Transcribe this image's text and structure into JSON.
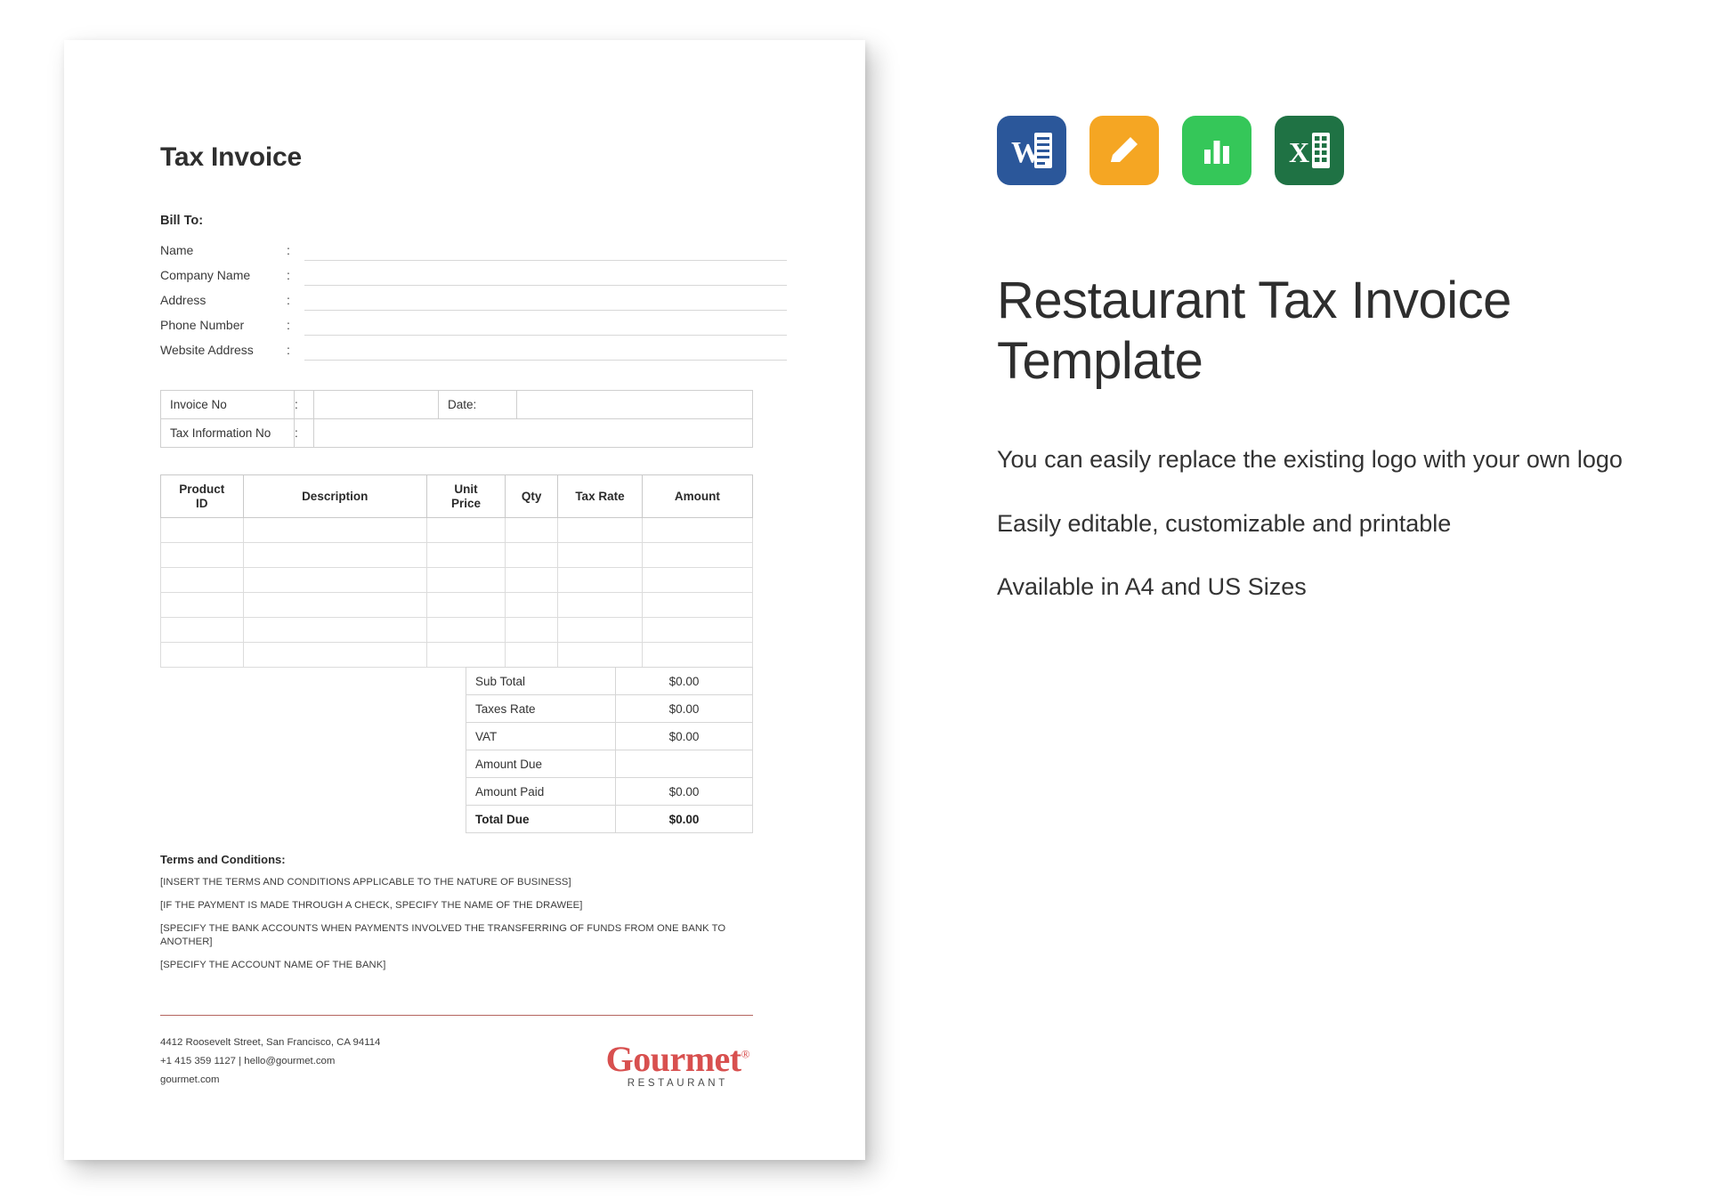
{
  "document": {
    "title": "Tax Invoice",
    "bill_to": {
      "heading": "Bill To:",
      "colon": ":",
      "fields": [
        {
          "label": "Name",
          "value": ""
        },
        {
          "label": "Company Name",
          "value": ""
        },
        {
          "label": "Address",
          "value": ""
        },
        {
          "label": "Phone Number",
          "value": ""
        },
        {
          "label": "Website Address",
          "value": ""
        }
      ]
    },
    "meta": {
      "invoice_no_label": "Invoice No",
      "invoice_no_value": "",
      "date_label": "Date:",
      "date_value": "",
      "tax_info_label": "Tax Information No",
      "tax_info_value": "",
      "colon": ":"
    },
    "items_table": {
      "headers": [
        "Product ID",
        "Description",
        "Unit Price",
        "Qty",
        "Tax Rate",
        "Amount"
      ],
      "header_product_id_line1": "Product",
      "header_product_id_line2": "ID",
      "header_description": "Description",
      "header_unit_line1": "Unit",
      "header_unit_line2": "Price",
      "header_qty": "Qty",
      "header_tax_rate": "Tax Rate",
      "header_amount": "Amount",
      "empty_row_count": 6,
      "rows": []
    },
    "totals": [
      {
        "label": "Sub Total",
        "value": "$0.00"
      },
      {
        "label": "Taxes Rate",
        "value": "$0.00"
      },
      {
        "label": "VAT",
        "value": "$0.00"
      },
      {
        "label": "Amount Due",
        "value": ""
      },
      {
        "label": "Amount Paid",
        "value": "$0.00"
      },
      {
        "label": "Total Due",
        "value": "$0.00"
      }
    ],
    "terms": {
      "title": "Terms and Conditions:",
      "lines": [
        "[INSERT THE TERMS AND CONDITIONS APPLICABLE TO THE NATURE OF BUSINESS]",
        "[IF THE PAYMENT IS MADE THROUGH A CHECK, SPECIFY THE NAME OF THE DRAWEE]",
        "[SPECIFY THE BANK ACCOUNTS WHEN PAYMENTS INVOLVED THE TRANSFERRING OF FUNDS FROM ONE BANK TO ANOTHER]",
        "[SPECIFY THE ACCOUNT NAME OF THE BANK]"
      ]
    },
    "footer": {
      "address": "4412 Roosevelt Street, San Francisco, CA 94114",
      "contact": "+1 415 359 1127 | hello@gourmet.com",
      "website": "gourmet.com",
      "logo_name": "Gourmet",
      "logo_trademark": "®",
      "logo_subtitle": "RESTAURANT",
      "logo_color": "#d8504f",
      "rule_color": "#b4655f"
    }
  },
  "promo": {
    "icons": [
      {
        "name": "microsoft-word-icon",
        "letter": "W",
        "color": "#2b579a"
      },
      {
        "name": "apple-pages-icon",
        "letter": "",
        "color": "#f5a623"
      },
      {
        "name": "apple-numbers-icon",
        "letter": "",
        "color": "#35c759"
      },
      {
        "name": "microsoft-excel-icon",
        "letter": "X",
        "color": "#1f7244"
      }
    ],
    "title": "Restaurant Tax Invoice Template",
    "features": [
      "You can easily replace the existing logo with your own logo",
      "Easily editable, customizable and printable",
      "Available in A4 and US Sizes"
    ]
  }
}
